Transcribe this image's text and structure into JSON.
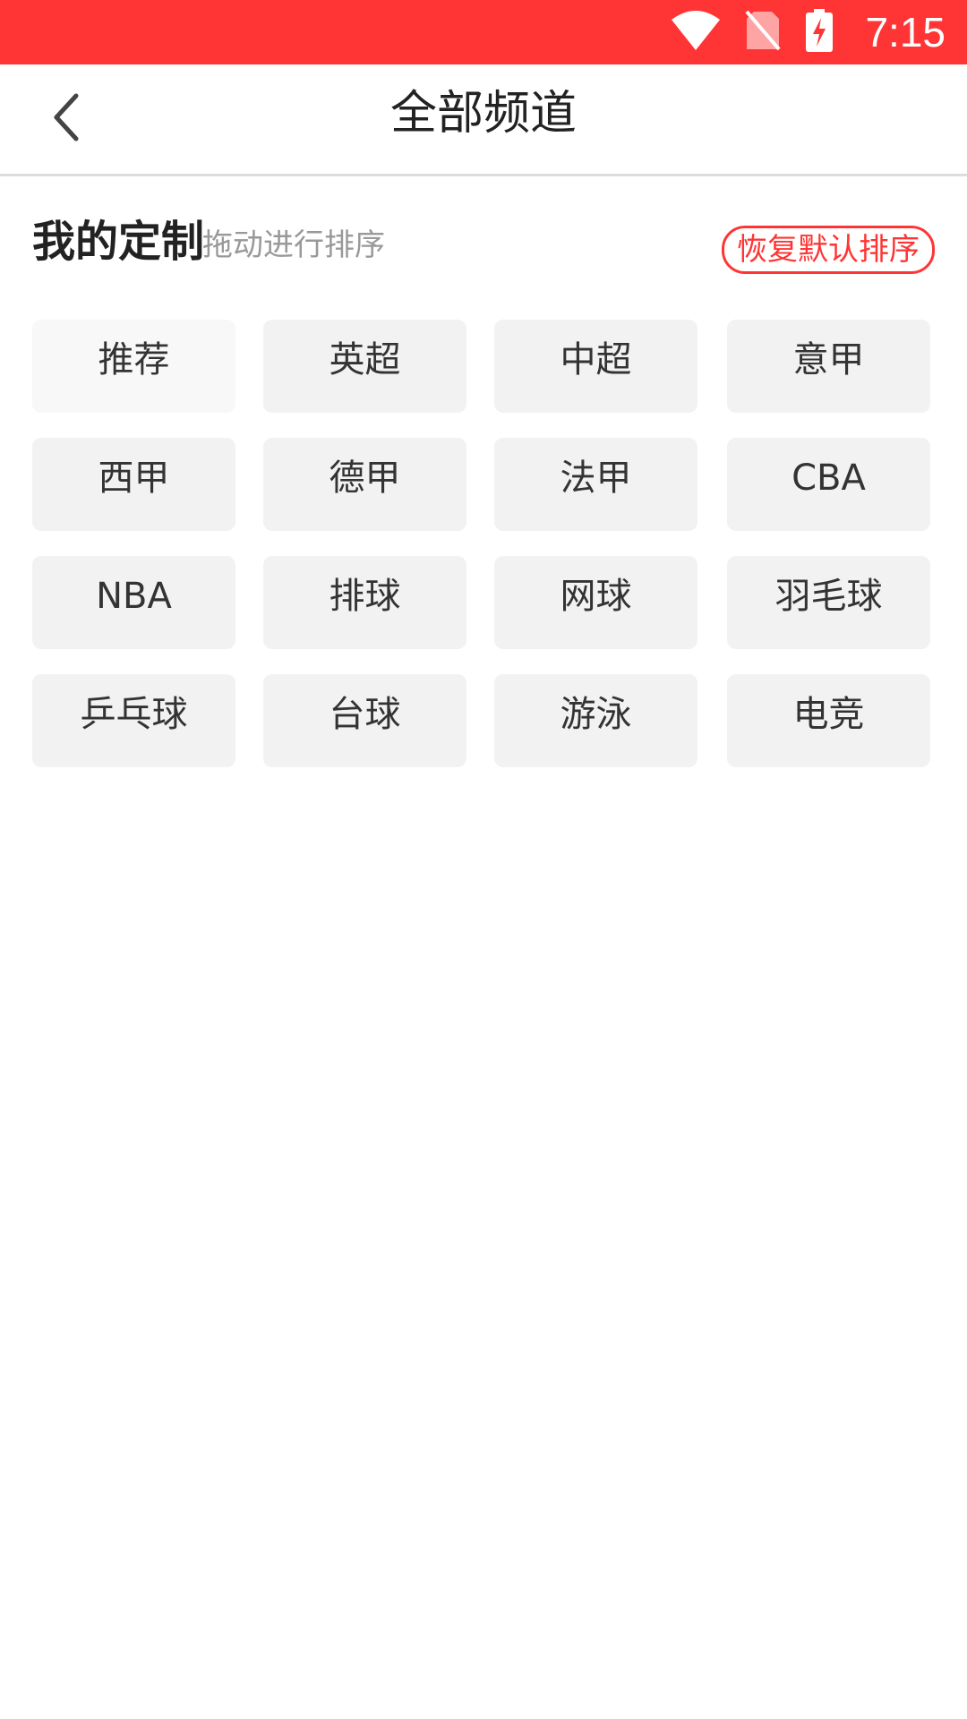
{
  "status_bar": {
    "time": "7:15",
    "icons": [
      "wifi-icon",
      "no-sim-icon",
      "battery-charging-icon"
    ],
    "color": "#ff3535"
  },
  "header": {
    "title": "全部频道",
    "back_icon": "chevron-left-icon"
  },
  "section": {
    "title": "我的定制",
    "hint": "拖动进行排序",
    "reset_label": "恢复默认排序",
    "accent": "#ff3535"
  },
  "channels": [
    {
      "label": "推荐"
    },
    {
      "label": "英超"
    },
    {
      "label": "中超"
    },
    {
      "label": "意甲"
    },
    {
      "label": "西甲"
    },
    {
      "label": "德甲"
    },
    {
      "label": "法甲"
    },
    {
      "label": "CBA"
    },
    {
      "label": "NBA"
    },
    {
      "label": "排球"
    },
    {
      "label": "网球"
    },
    {
      "label": "羽毛球"
    },
    {
      "label": "乒乓球"
    },
    {
      "label": "台球"
    },
    {
      "label": "游泳"
    },
    {
      "label": "电竞"
    }
  ]
}
